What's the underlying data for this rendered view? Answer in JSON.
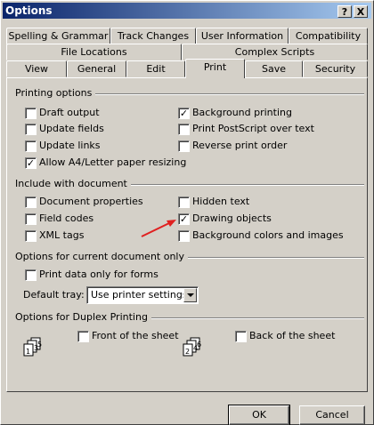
{
  "window": {
    "title": "Options"
  },
  "titlebar_buttons": {
    "help": "?",
    "close": "X"
  },
  "tabs": {
    "row1": [
      "Spelling & Grammar",
      "Track Changes",
      "User Information",
      "Compatibility"
    ],
    "row2": [
      "File Locations",
      "Complex Scripts"
    ],
    "row3": [
      "View",
      "General",
      "Edit",
      "Print",
      "Save",
      "Security"
    ],
    "active": "Print"
  },
  "printing_options": {
    "title": "Printing options",
    "items": [
      {
        "label": "Draft output",
        "checked": false
      },
      {
        "label": "Update fields",
        "checked": false
      },
      {
        "label": "Update links",
        "checked": false
      },
      {
        "label": "Allow A4/Letter paper resizing",
        "checked": true
      },
      {
        "label": "Background printing",
        "checked": true
      },
      {
        "label": "Print PostScript over text",
        "checked": false
      },
      {
        "label": "Reverse print order",
        "checked": false
      }
    ]
  },
  "include_with_document": {
    "title": "Include with document",
    "items": [
      {
        "label": "Document properties",
        "checked": false
      },
      {
        "label": "Field codes",
        "checked": false
      },
      {
        "label": "XML tags",
        "checked": false
      },
      {
        "label": "Hidden text",
        "checked": false
      },
      {
        "label": "Drawing objects",
        "checked": true
      },
      {
        "label": "Background colors and images",
        "checked": false
      }
    ]
  },
  "current_document": {
    "title": "Options for current document only",
    "print_forms_label": "Print data only for forms",
    "print_forms_checked": false,
    "default_tray_label": "Default tray:",
    "default_tray_value": "Use printer settings"
  },
  "duplex": {
    "title": "Options for Duplex Printing",
    "front_label": "Front of the sheet",
    "front_checked": false,
    "back_label": "Back of the sheet",
    "back_checked": false
  },
  "buttons": {
    "ok": "OK",
    "cancel": "Cancel"
  },
  "colors": {
    "titlebar_start": "#0a246a",
    "titlebar_end": "#a6caf0",
    "face": "#d4d0c8",
    "annotation_arrow": "#e02020"
  }
}
